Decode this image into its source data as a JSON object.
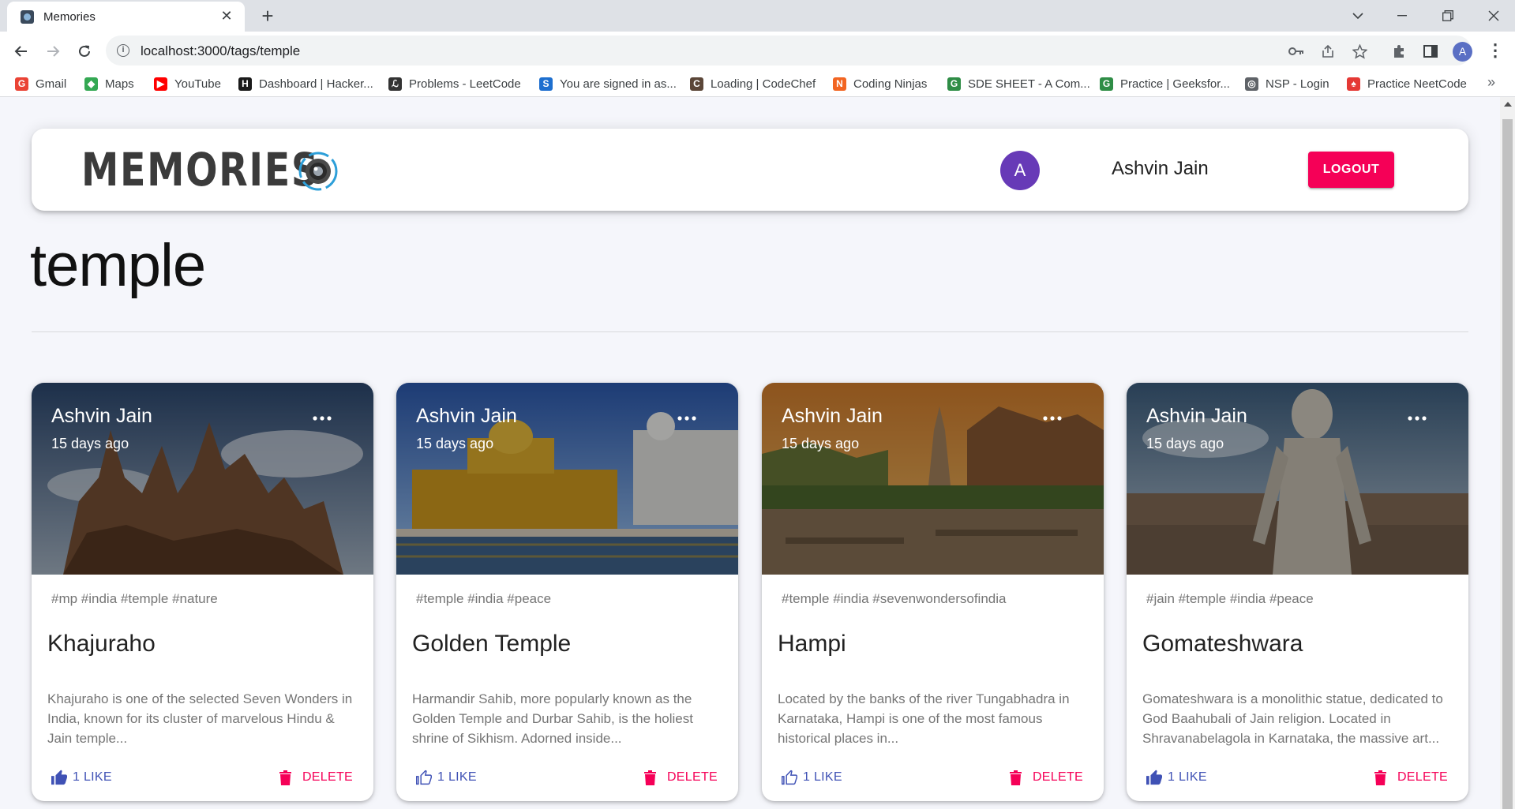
{
  "browser": {
    "tab_title": "Memories",
    "url": "localhost:3000/tags/temple",
    "profile_initial": "A",
    "bookmarks": [
      {
        "label": "Gmail",
        "icon": "gmail-icon",
        "color": "#ea4335",
        "glyph": "G"
      },
      {
        "label": "Maps",
        "icon": "maps-icon",
        "color": "#34a853",
        "glyph": "◆"
      },
      {
        "label": "YouTube",
        "icon": "youtube-icon",
        "color": "#ff0000",
        "glyph": "▶"
      },
      {
        "label": "Dashboard | Hacker...",
        "icon": "hackerrank-icon",
        "color": "#1a1a1a",
        "glyph": "H"
      },
      {
        "label": "Problems - LeetCode",
        "icon": "leetcode-icon",
        "color": "#333333",
        "glyph": "ℒ"
      },
      {
        "label": "You are signed in as...",
        "icon": "spoj-icon",
        "color": "#1e6fcf",
        "glyph": "S"
      },
      {
        "label": "Loading | CodeChef",
        "icon": "codechef-icon",
        "color": "#5b4638",
        "glyph": "C"
      },
      {
        "label": "Coding Ninjas",
        "icon": "codingninjas-icon",
        "color": "#f26522",
        "glyph": "N"
      },
      {
        "label": "SDE SHEET - A Com...",
        "icon": "gfg-icon",
        "color": "#2f8d46",
        "glyph": "G"
      },
      {
        "label": "Practice | Geeksfor...",
        "icon": "gfg-practice-icon",
        "color": "#2f8d46",
        "glyph": "G"
      },
      {
        "label": "NSP - Login",
        "icon": "globe-icon",
        "color": "#5f6368",
        "glyph": "◎"
      },
      {
        "label": "Practice NeetCode",
        "icon": "neetcode-icon",
        "color": "#e53935",
        "glyph": "♠"
      }
    ]
  },
  "app": {
    "brand": "MEMORIES",
    "user_initial": "A",
    "user_name": "Ashvin Jain",
    "logout_label": "LOGOUT",
    "tag_heading": "temple"
  },
  "posts": [
    {
      "author": "Ashvin Jain",
      "time": "15 days ago",
      "tags": "#mp #india #temple #nature",
      "title": "Khajuraho",
      "description": "Khajuraho is one of the selected Seven Wonders in India, known for its cluster of marvelous Hindu & Jain temple...",
      "like_label": "1 LIKE",
      "delete_label": "DELETE"
    },
    {
      "author": "Ashvin Jain",
      "time": "15 days ago",
      "tags": "#temple #india #peace",
      "title": "Golden Temple",
      "description": "Harmandir Sahib, more popularly known as the Golden Temple and Durbar Sahib, is the holiest shrine of Sikhism. Adorned inside...",
      "like_label": "1 LIKE",
      "delete_label": "DELETE"
    },
    {
      "author": "Ashvin Jain",
      "time": "15 days ago",
      "tags": "#temple #india #sevenwondersofindia",
      "title": "Hampi",
      "description": "Located by the banks of the river Tungabhadra in Karnataka, Hampi is one of the most famous historical places in...",
      "like_label": "1 LIKE",
      "delete_label": "DELETE"
    },
    {
      "author": "Ashvin Jain",
      "time": "15 days ago",
      "tags": "#jain #temple #india #peace",
      "title": "Gomateshwara",
      "description": "Gomateshwara is a monolithic statue, dedicated to God Baahubali of Jain religion. Located in Shravanabelagola in Karnataka, the massive art...",
      "like_label": "1 LIKE",
      "delete_label": "DELETE"
    }
  ],
  "colors": {
    "accent_pink": "#f50057",
    "like_blue": "#3f51b5",
    "avatar_purple": "#673ab7",
    "page_bg": "#f5f6fb"
  }
}
